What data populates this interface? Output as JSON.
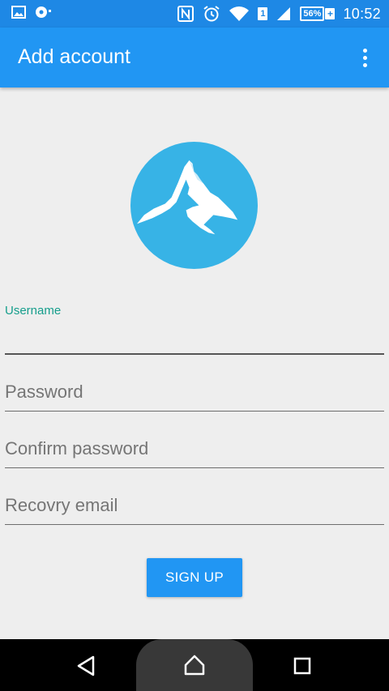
{
  "status_bar": {
    "time": "10:52",
    "battery": "56%",
    "battery_plus": "+",
    "sim_badge": "1"
  },
  "app_bar": {
    "title": "Add account",
    "overflow_icon": "more-vert-icon"
  },
  "logo": {
    "icon": "mountain-icon",
    "bg_color": "#37b3e6"
  },
  "form": {
    "username_label": "Username",
    "username_value": "",
    "password_placeholder": "Password",
    "confirm_password_placeholder": "Confirm password",
    "recovery_email_placeholder": "Recovry email",
    "signup_label": "SIGN UP"
  },
  "colors": {
    "primary": "#2196f3",
    "status_bar": "#1e88e5",
    "accent_label": "#169e8c",
    "background": "#eeeeee"
  },
  "nav_bar": {
    "back_icon": "back-icon",
    "home_icon": "home-icon",
    "recents_icon": "recents-icon"
  }
}
